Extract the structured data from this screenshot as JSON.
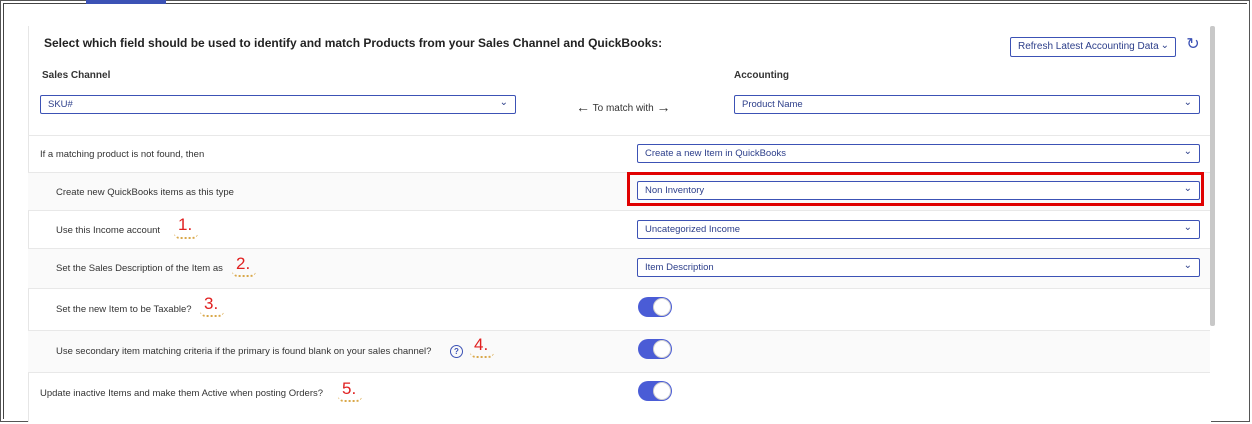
{
  "heading": "Select which field should be used to identify and match Products from your Sales Channel and QuickBooks:",
  "refresh": {
    "label": "Refresh Latest Accounting Data"
  },
  "sales_channel": {
    "label": "Sales Channel",
    "value": "SKU#"
  },
  "accounting": {
    "label": "Accounting",
    "value": "Product Name"
  },
  "match_text": "To match with",
  "rows": [
    {
      "label": "If a matching product is not found, then",
      "value": "Create a new Item in QuickBooks"
    },
    {
      "label": "Create new QuickBooks items as this type",
      "value": "Non Inventory"
    },
    {
      "label": "Use this Income account",
      "value": "Uncategorized Income",
      "annotation": "1."
    },
    {
      "label": "Set the Sales Description of the Item as",
      "value": "Item Description",
      "annotation": "2."
    },
    {
      "label": "Set the new Item to be Taxable?",
      "toggle": true,
      "annotation": "3."
    },
    {
      "label": "Use secondary item matching criteria if the primary is found blank on your sales channel?",
      "toggle": true,
      "annotation": "4."
    },
    {
      "label": "Update inactive Items and make them Active when posting Orders?",
      "toggle": true,
      "annotation": "5."
    }
  ],
  "colors": {
    "accent": "#3c52b5",
    "toggle_on": "#4a5cd6",
    "highlight": "#e00000",
    "annotation": "#e02020"
  },
  "icons": {
    "chevron": "chevron-down-icon",
    "refresh": "refresh-icon",
    "help": "help-icon",
    "arrow_left": "arrow-left-icon",
    "arrow_right": "arrow-right-icon"
  }
}
